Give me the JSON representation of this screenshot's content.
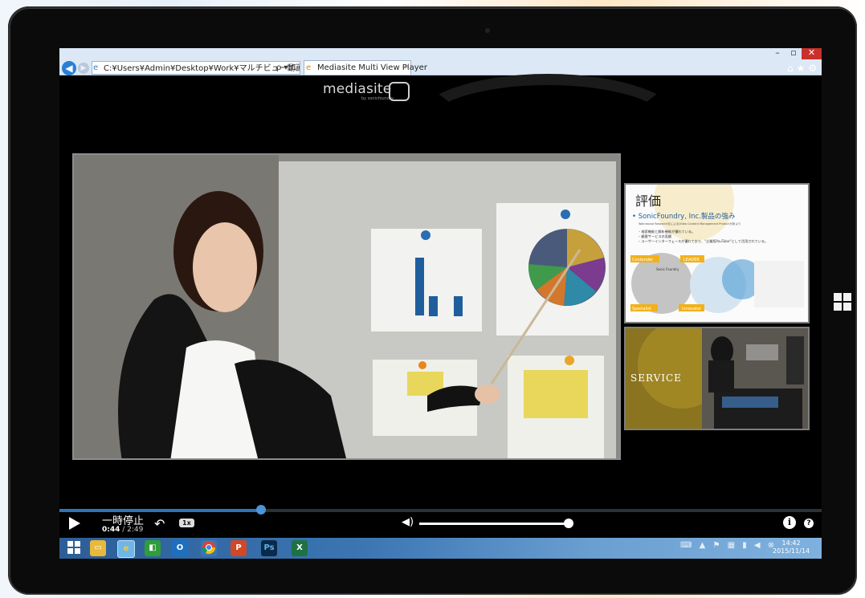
{
  "browser": {
    "address": "C:¥Users¥Admin¥Desktop¥Work¥マルチビュー動画¥[publisl",
    "address_tools": "ρ ▾ C",
    "tab_title": "Mediasite Multi View Player",
    "tab_close": "×",
    "minimize": "–",
    "maximize": "▫",
    "close": "✕",
    "toolbar_icons": "⌂★⚙"
  },
  "logo": {
    "text": "mediasite",
    "subtext": "by sonicfoundry"
  },
  "slide": {
    "title": "評価",
    "bullet_main": "• SonicFoundry, Inc.製品の強み",
    "sub_line": "Wainhouse Research社によるVideo Content Management Product分析より",
    "points": [
      "– 検索機能と解析機能が優れている。",
      "– 顧客サービスの実績",
      "– ユーザーインターフェースが優れており、\"企業版YouTube\"として活用されている。"
    ],
    "quadrants": [
      "Contender",
      "LEADER",
      "Specialist",
      "Innovator"
    ],
    "chart_label": "Sonic Foundry"
  },
  "camera2": {
    "label": "SERVICE"
  },
  "player": {
    "status": "一時停止",
    "time_current": "0:44",
    "time_separator": " / ",
    "time_total": "2:49",
    "progress_fraction": 0.264,
    "speed": "1x",
    "volume_fraction": 1.0,
    "info": "i",
    "help": "?"
  },
  "taskbar": {
    "apps": [
      "start",
      "file-explorer",
      "internet-explorer",
      "store",
      "outlook",
      "chrome",
      "powerpoint",
      "photoshop",
      "excel"
    ],
    "tray_icons": "⌨ ▲ ⚑ ▦ ▮ ◀ ⊗",
    "time": "14:42",
    "date": "2015/11/14"
  },
  "colors": {
    "accent": "#2d74b8",
    "taskbar": "#3b76b3",
    "close_button": "#c9302c"
  }
}
